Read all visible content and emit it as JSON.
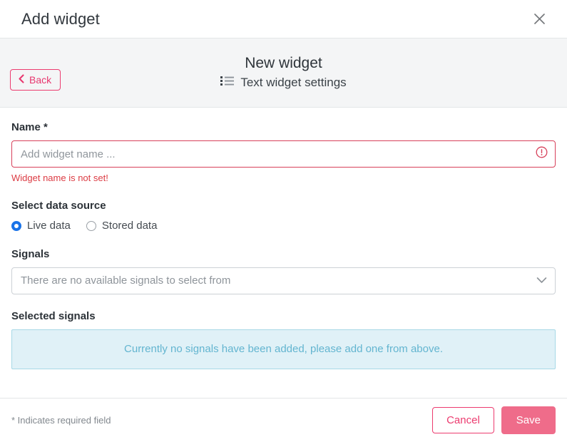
{
  "dialog": {
    "title": "Add widget",
    "close_icon": "close-icon"
  },
  "subheader": {
    "title": "New widget",
    "subtitle": "Text widget settings",
    "subtitle_icon": "list-icon",
    "back_label": "Back",
    "back_icon": "chevron-left-icon"
  },
  "form": {
    "name": {
      "label": "Name *",
      "value": "",
      "placeholder": "Add widget name ...",
      "error": "Widget name is not set!",
      "error_icon": "exclamation-circle-icon"
    },
    "data_source": {
      "label": "Select data source",
      "options": [
        {
          "label": "Live data",
          "selected": true
        },
        {
          "label": "Stored data",
          "selected": false
        }
      ]
    },
    "signals": {
      "label": "Signals",
      "placeholder": "There are no available signals to select from",
      "value": "",
      "chevron_icon": "chevron-down-icon"
    },
    "selected_signals": {
      "label": "Selected signals",
      "empty_message": "Currently no signals have been added, please add one from above."
    }
  },
  "footer": {
    "required_note": "* Indicates required field",
    "cancel_label": "Cancel",
    "save_label": "Save"
  },
  "colors": {
    "accent_pink": "#ec3b6f",
    "save_pink": "#ef6c8a",
    "error_red": "#dc3c44",
    "radio_blue": "#1a73e8",
    "info_bg": "#e0f1f7",
    "info_text": "#63b5d0",
    "header_bg": "#f4f5f6"
  }
}
